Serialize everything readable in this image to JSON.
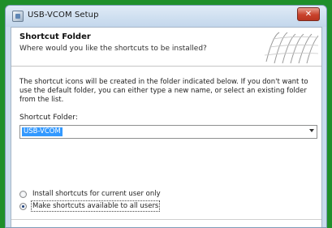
{
  "window": {
    "title": "USB-VCOM Setup",
    "close_glyph": "✕"
  },
  "header": {
    "title": "Shortcut Folder",
    "subtitle": "Where would you like the shortcuts to be installed?"
  },
  "description": "The shortcut icons will be created in the folder indicated below. If you don't want to use the default folder, you can either type a new name, or select an existing folder from the list.",
  "shortcut_folder": {
    "label": "Shortcut Folder:",
    "value": "USB-VCOM"
  },
  "options": [
    {
      "label": "Install shortcuts for current user only",
      "selected": false
    },
    {
      "label": "Make shortcuts available to all users",
      "selected": true
    }
  ],
  "colors": {
    "desktop_background": "#1f8f2a",
    "selection": "#3399ff",
    "close_button": "#c9432c"
  },
  "icons": [
    "app-icon",
    "close-icon",
    "header-graphic",
    "dropdown-arrow-icon"
  ]
}
